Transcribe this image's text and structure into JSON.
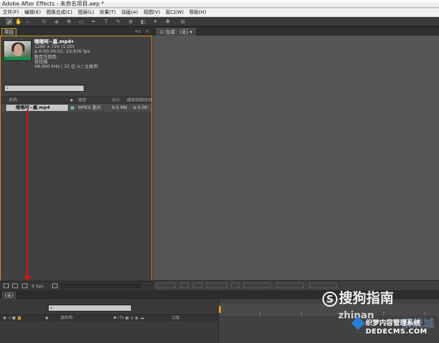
{
  "window": {
    "title": "Adobe After Effects - 未命名项目.aep *"
  },
  "menu": [
    "文件(F)",
    "编辑(E)",
    "图像合成(C)",
    "图层(L)",
    "效果(T)",
    "动画(A)",
    "视图(V)",
    "窗口(W)",
    "帮助(H)"
  ],
  "project": {
    "tab": "项目",
    "file": {
      "name": "嗯嗯呵~嘉.mp4▾",
      "resolution": "1280 x 720 (1.00)",
      "duration": "Δ 0:00:30:01, 23.976 fps",
      "colors": "数百万颜色",
      "compression": "非压缩",
      "audio": "48.000 kHz / 32 位 U / 立体声"
    },
    "columns": {
      "name": "名称",
      "type": "类型",
      "size": "大小",
      "duration": "媒体持续时间"
    },
    "rows": [
      {
        "name": "嗯嗯呵~嘉.mp4",
        "type": "MPEG 影片",
        "size": "9.5 MB",
        "duration": "Δ 0:00"
      }
    ],
    "bpc": "8 bpc"
  },
  "comp": {
    "tab": "合成：(无)"
  },
  "timeline": {
    "tab": "(无)",
    "source_col": "源名称",
    "parent_col": "父级"
  },
  "watermarks": {
    "sogou": "搜狗指南",
    "sogou_s": "S",
    "zhinan": "zhinan",
    "dede1": "织梦内容管理系统",
    "dede2": "DEDECMS.COM",
    "xitong": "系统城"
  }
}
